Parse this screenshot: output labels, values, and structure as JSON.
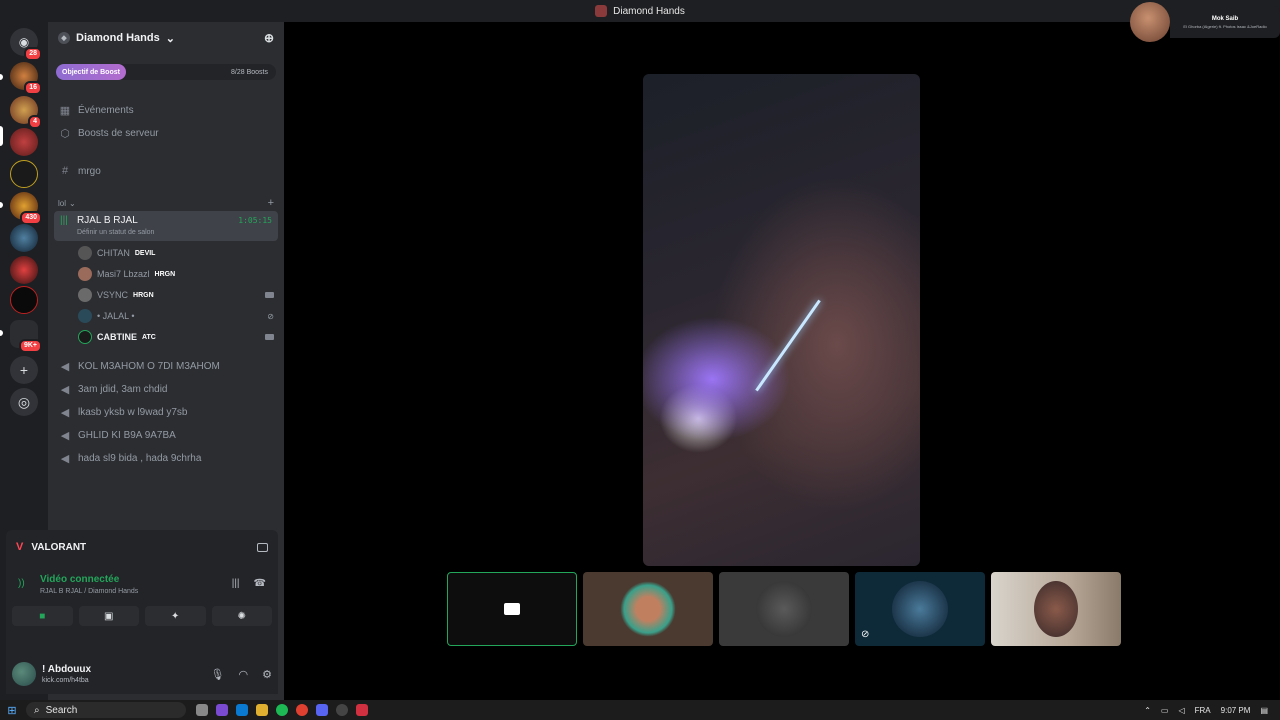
{
  "window": {
    "title": "Diamond Hands"
  },
  "rail": {
    "badges": [
      "28",
      "16",
      "4",
      "430",
      "9K+"
    ]
  },
  "guild": {
    "name": "Diamond Hands",
    "boost_goal_label": "Objectif de Boost",
    "boost_count": "8/28 Boosts"
  },
  "channels": {
    "events": "Événements",
    "server_boosts": "Boosts de serveur",
    "text_channel": "mrgo",
    "category": "lol",
    "active_voice": {
      "name": "RJAL B RJAL",
      "status": "Définir un statut de salon",
      "timer": "1:05:15"
    },
    "members": [
      {
        "name": "CHITAN",
        "tag": "DEVIL"
      },
      {
        "name": "Masi7 Lbzazl",
        "tag": "HRGN"
      },
      {
        "name": "VSYNC",
        "tag": "HRGN"
      },
      {
        "name": "• JALAL •",
        "tag": ""
      },
      {
        "name": "CABTINE",
        "tag": "ATC"
      }
    ],
    "voice_channels": [
      "KOL M3AHOM O 7DI M3AHOM",
      "3am jdid, 3am chdid",
      "lkasb yksb w l9wad y7sb",
      "GHLID KI B9A 9A7BA",
      "hada sl9 bida , hada 9chrha"
    ]
  },
  "activity": {
    "game": "VALORANT"
  },
  "voice_panel": {
    "status": "Vidéo connectée",
    "location": "RJAL B RJAL / Diamond Hands"
  },
  "user": {
    "name": "! Abdouux",
    "status": "kick.com/h4tba"
  },
  "overlay": {
    "name": "Mok Saib",
    "song": "El Ghorba (Algerie) ft. Photos Issac &JoeRadio"
  },
  "taskbar": {
    "search": "Search",
    "lang": "FRA",
    "time": "9:07 PM"
  },
  "colors": {
    "green": "#23a55a",
    "red": "#f23f43",
    "sidebar": "#2b2d31",
    "rail": "#1e1f22"
  }
}
